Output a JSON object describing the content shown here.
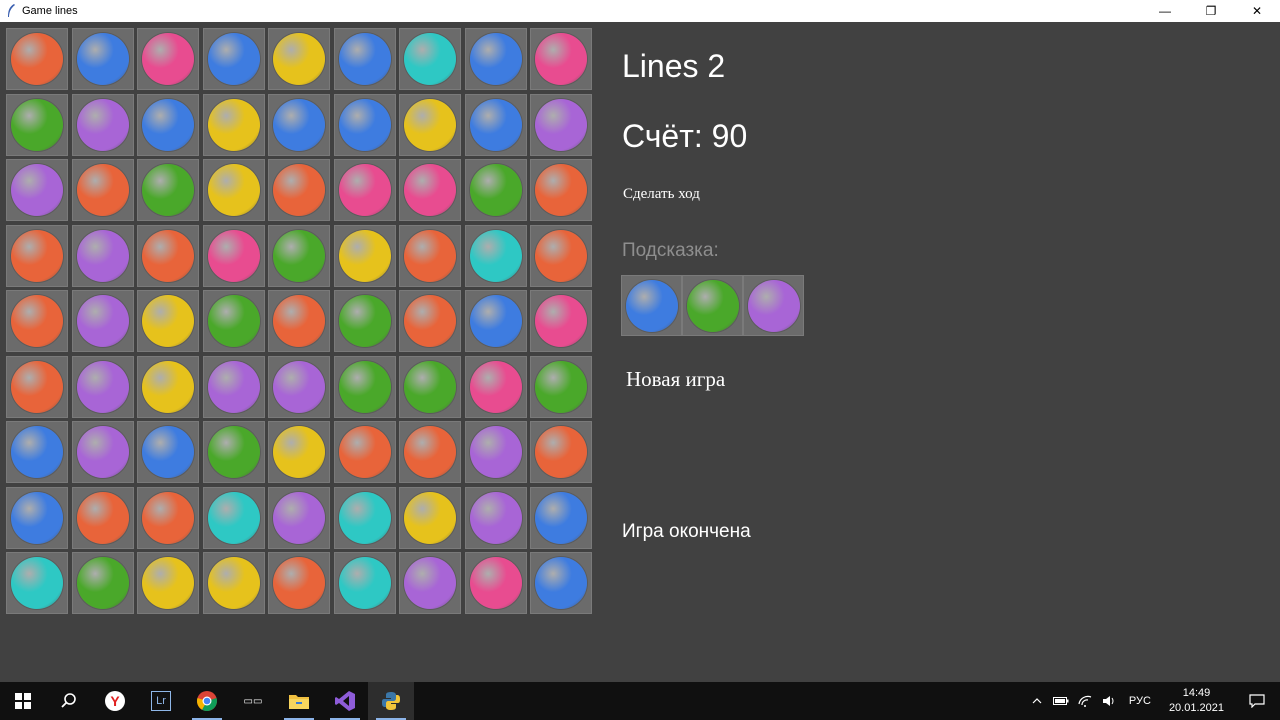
{
  "window": {
    "title": "Game lines",
    "minimize_glyph": "—",
    "restore_glyph": "❐",
    "close_glyph": "✕"
  },
  "palette": {
    "orange": "#e8643a",
    "blue": "#3e7ce0",
    "pink": "#e84c90",
    "yellow": "#e6c21c",
    "cyan": "#2ec8c4",
    "green": "#4aa82a",
    "purple": "#a865d6"
  },
  "board": {
    "rows": [
      [
        "orange",
        "blue",
        "pink",
        "blue",
        "yellow",
        "blue",
        "cyan",
        "blue",
        "pink"
      ],
      [
        "green",
        "purple",
        "blue",
        "yellow",
        "blue",
        "blue",
        "yellow",
        "blue",
        "purple"
      ],
      [
        "purple",
        "orange",
        "green",
        "yellow",
        "orange",
        "pink",
        "pink",
        "green",
        "orange"
      ],
      [
        "orange",
        "purple",
        "orange",
        "pink",
        "green",
        "yellow",
        "orange",
        "cyan",
        "orange"
      ],
      [
        "orange",
        "purple",
        "yellow",
        "green",
        "orange",
        "green",
        "orange",
        "blue",
        "pink"
      ],
      [
        "orange",
        "purple",
        "yellow",
        "purple",
        "purple",
        "green",
        "green",
        "pink",
        "green"
      ],
      [
        "blue",
        "purple",
        "blue",
        "green",
        "yellow",
        "orange",
        "orange",
        "purple",
        "orange"
      ],
      [
        "blue",
        "orange",
        "orange",
        "cyan",
        "purple",
        "cyan",
        "yellow",
        "purple",
        "blue"
      ],
      [
        "cyan",
        "green",
        "yellow",
        "yellow",
        "orange",
        "cyan",
        "purple",
        "pink",
        "blue"
      ]
    ]
  },
  "panel": {
    "title": "Lines 2",
    "score": "Счёт: 90",
    "make_move": "Сделать ход",
    "hint_label": "Подсказка:",
    "hint_balls": [
      "blue",
      "green",
      "purple"
    ],
    "new_game": "Новая игра",
    "game_over": "Игра окончена"
  },
  "taskbar": {
    "apps": [
      {
        "name": "start-button",
        "icon": "windows-icon"
      },
      {
        "name": "search-button",
        "icon": "search-icon"
      },
      {
        "name": "yandex-browser",
        "icon": "yandex-icon"
      },
      {
        "name": "lightroom",
        "icon": "lightroom-icon"
      },
      {
        "name": "chrome",
        "icon": "chrome-icon"
      },
      {
        "name": "media-app",
        "icon": "media-icon"
      },
      {
        "name": "file-explorer",
        "icon": "folder-icon"
      },
      {
        "name": "visual-studio",
        "icon": "visual-studio-icon"
      },
      {
        "name": "python-app",
        "icon": "python-icon"
      }
    ],
    "lightroom_label": "Lr",
    "media_label": "▭▭",
    "language": "РУС",
    "time": "14:49",
    "date": "20.01.2021"
  }
}
